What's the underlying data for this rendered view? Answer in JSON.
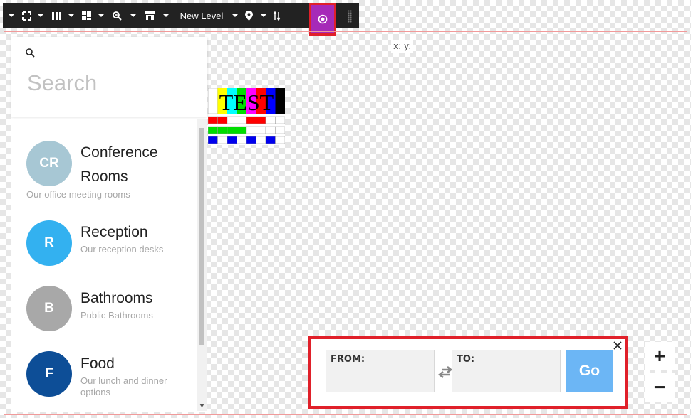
{
  "toolbar": {
    "level_label": "New Level",
    "items": [
      "fullscreen-icon",
      "columns-icon",
      "layout-icon",
      "zoom-icon",
      "store-icon",
      "marker-icon",
      "sort-icon",
      "locate-icon"
    ]
  },
  "colors": {
    "toolbar_bg": "#222222",
    "active_tool": "#a62ab8",
    "highlight": "#e0202a",
    "go": "#6cb6f5"
  },
  "coords": {
    "text": "x: y:"
  },
  "sidebar": {
    "search_placeholder": "Search",
    "items": [
      {
        "initials": "CR",
        "title": "Conference Rooms",
        "subtitle": "Our office meeting rooms",
        "color": "#a7c7d4"
      },
      {
        "initials": "R",
        "title": "Reception",
        "subtitle": "Our reception desks",
        "color": "#33b1f0"
      },
      {
        "initials": "B",
        "title": "Bathrooms",
        "subtitle": "Public Bathrooms",
        "color": "#a8a8a8"
      },
      {
        "initials": "F",
        "title": "Food",
        "subtitle": "Our lunch and dinner options",
        "color": "#0d4e97"
      }
    ]
  },
  "test_pattern": {
    "label": "TEST"
  },
  "directions": {
    "from_label": "FROM:",
    "to_label": "TO:",
    "go_label": "Go"
  },
  "zoom": {
    "in_label": "+",
    "out_label": "−"
  }
}
